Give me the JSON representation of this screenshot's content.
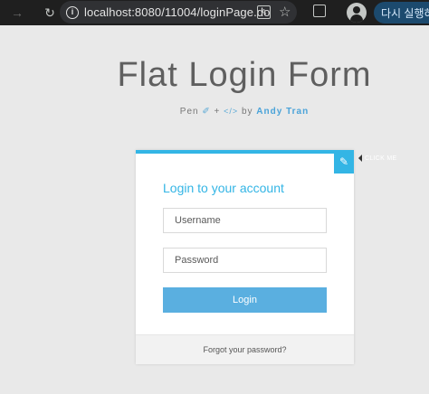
{
  "browser": {
    "url": "localhost:8080/11004/loginPage.do",
    "relaunch_label": "다시 실행하여"
  },
  "page": {
    "title": "Flat Login Form",
    "credit_prefix": "Pen",
    "credit_plus": "+",
    "credit_code": "</>",
    "credit_by": "by",
    "author": "Andy Tran"
  },
  "form": {
    "toggle_tooltip": "CLICK ME",
    "heading": "Login to your account",
    "username_placeholder": "Username",
    "password_placeholder": "Password",
    "login_label": "Login",
    "forgot_label": "Forgot your password?"
  },
  "colors": {
    "accent": "#33b5e5",
    "button": "#5aafe0",
    "background": "#e9e9e9"
  }
}
